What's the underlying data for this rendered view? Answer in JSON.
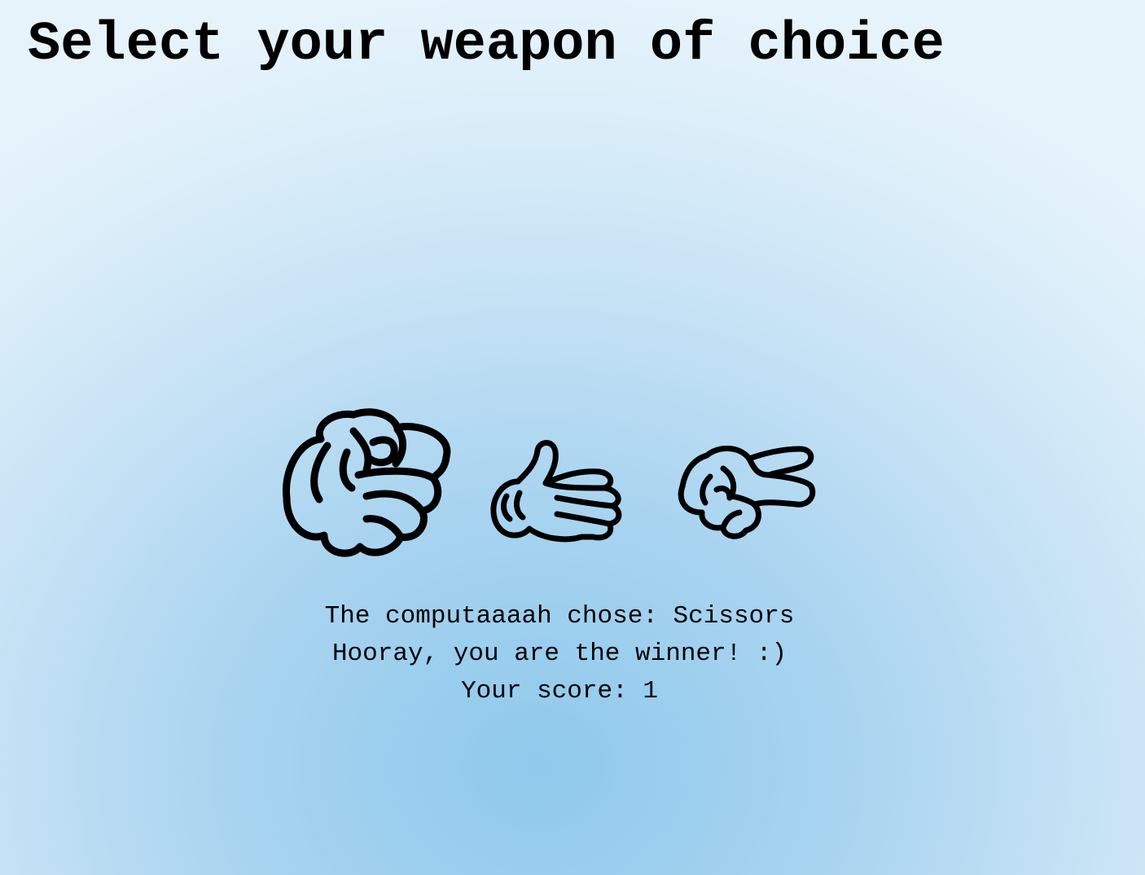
{
  "title": "Select your weapon of choice",
  "weapons": [
    {
      "name": "Rock",
      "icon": "rock-fist-icon"
    },
    {
      "name": "Paper",
      "icon": "paper-hand-icon"
    },
    {
      "name": "Scissors",
      "icon": "scissors-hand-icon"
    }
  ],
  "result": {
    "computer_choice_label": "The computaaaah chose:",
    "computer_choice": "Scissors",
    "outcome": "Hooray, you are the winner! :)",
    "score_label": "Your score:",
    "score": "1"
  },
  "colors": {
    "background_center": "#8fc9ec",
    "background_edge": "#e6f3fb",
    "ink": "#000000"
  }
}
